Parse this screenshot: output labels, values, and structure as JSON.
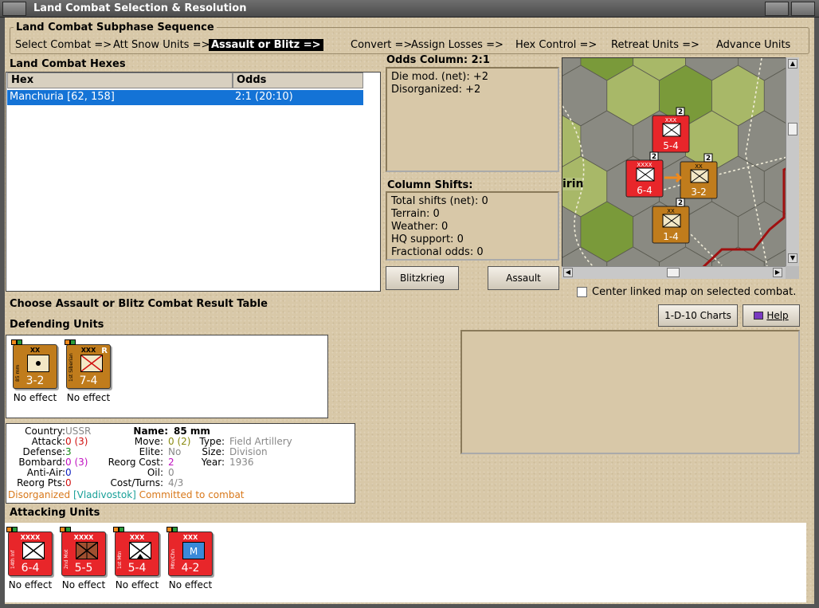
{
  "window": {
    "title": "Land Combat Selection & Resolution"
  },
  "subphase": {
    "title": "Land Combat Subphase Sequence",
    "steps": [
      {
        "label": "Select Combat =>",
        "active": false
      },
      {
        "label": "Att Snow Units =>",
        "active": false
      },
      {
        "label": "Assault or Blitz =>",
        "active": true
      },
      {
        "label": "Convert =>",
        "active": false
      },
      {
        "label": "Assign Losses =>",
        "active": false
      },
      {
        "label": "Hex Control =>",
        "active": false
      },
      {
        "label": "Retreat Units =>",
        "active": false
      },
      {
        "label": "Advance Units",
        "active": false
      }
    ]
  },
  "hexes": {
    "title": "Land Combat Hexes",
    "columns": [
      "Hex",
      "Odds"
    ],
    "rows": [
      {
        "hex": "Manchuria [62, 158]",
        "odds": "2:1 (20:10)",
        "selected": true
      }
    ]
  },
  "odds": {
    "title": "Odds Column: 2:1",
    "lines": [
      "Die mod. (net): +2",
      "Disorganized: +2"
    ]
  },
  "shifts": {
    "title": "Column Shifts:",
    "lines": [
      "Total shifts (net): 0",
      "Terrain: 0",
      "Weather: 0",
      "HQ support: 0",
      "Fractional odds: 0"
    ]
  },
  "buttons": {
    "blitzkrieg": "Blitzkrieg",
    "assault": "Assault",
    "charts": "1-D-10 Charts",
    "help": "Help"
  },
  "center_map": {
    "label": "Center linked map on selected combat.",
    "checked": false
  },
  "choose_label": "Choose Assault or Blitz Combat Result Table",
  "defending": {
    "title": "Defending Units",
    "units": [
      {
        "size": "XX",
        "side": "85 mm",
        "stats": "3-2",
        "color": "gold",
        "symbol": "artillery",
        "result": "No effect",
        "reserve": ""
      },
      {
        "size": "XXX",
        "side": "1st Siberian",
        "stats": "7-4",
        "color": "gold",
        "symbol": "infantry",
        "result": "No effect",
        "reserve": "R"
      }
    ]
  },
  "unit_info": {
    "country_label": "Country:",
    "country": "USSR",
    "attack_label": "Attack:",
    "attack": "0",
    "attack_base": "(3)",
    "defense_label": "Defense:",
    "defense": "3",
    "bombard_label": "Bombard:",
    "bombard": "0",
    "bombard_base": "(3)",
    "antiair_label": "Anti-Air:",
    "antiair": "0",
    "reorg_pts_label": "Reorg Pts:",
    "reorg_pts": "0",
    "name_label": "Name:",
    "name": "85 mm",
    "move_label": "Move:",
    "move": "0",
    "move_base": "(2)",
    "elite_label": "Elite:",
    "elite": "No",
    "reorg_cost_label": "Reorg Cost:",
    "reorg_cost": "2",
    "oil_label": "Oil:",
    "oil": "0",
    "cost_turns_label": "Cost/Turns:",
    "cost_turns": "4/3",
    "type_label": "Type:",
    "type": "Field Artillery",
    "size_label": "Size:",
    "size": "Division",
    "year_label": "Year:",
    "year": "1936",
    "status_disorg": "Disorganized",
    "status_hq": "[Vladivostok]",
    "status_committed": "Committed to combat"
  },
  "attacking": {
    "title": "Attacking Units",
    "units": [
      {
        "size": "XXXX",
        "side": "14th Inf",
        "stats": "6-4",
        "color": "red",
        "symbol": "infantry",
        "result": "No effect"
      },
      {
        "size": "XXXX",
        "side": "2nd Mot",
        "stats": "5-5",
        "color": "red",
        "symbol": "motorized",
        "result": "No effect"
      },
      {
        "size": "XXX",
        "side": "1st Mtn",
        "stats": "5-4",
        "color": "red",
        "symbol": "mountain",
        "result": "No effect"
      },
      {
        "size": "XXX",
        "side": "Mtn/Chn",
        "stats": "4-2",
        "color": "red",
        "symbol": "marine",
        "result": "No effect"
      }
    ]
  },
  "map": {
    "place_label": "irin",
    "counters": [
      {
        "stats": "5-4",
        "size": "XXX",
        "color": "red"
      },
      {
        "stats": "6-4",
        "size": "XXXX",
        "color": "red"
      },
      {
        "stats": "3-2",
        "size": "XX",
        "color": "gold"
      },
      {
        "stats": "1-4",
        "size": "XX",
        "color": "gold"
      }
    ],
    "stack_counts": [
      "2",
      "2",
      "2",
      "2"
    ]
  },
  "colors": {
    "red_unit": "#e8262a",
    "axis_unit": "#c07c1c",
    "selection": "#1473d6"
  }
}
